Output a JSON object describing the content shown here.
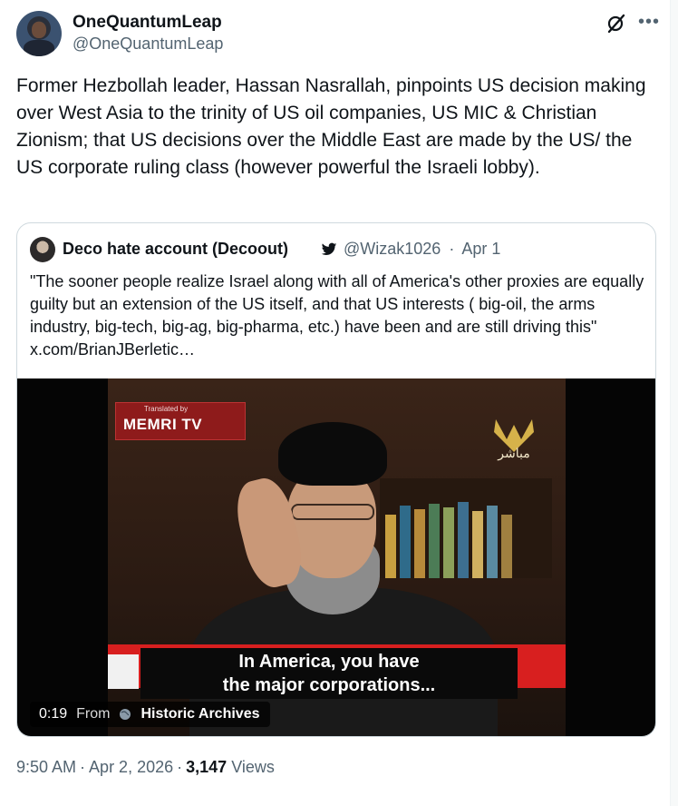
{
  "author": {
    "name": "OneQuantumLeap",
    "handle": "@OneQuantumLeap"
  },
  "post": {
    "text": "Former Hezbollah leader, Hassan Nasrallah, pinpoints US decision making over West Asia to the trinity of US oil companies, US MIC & Christian Zionism; that US decisions over the Middle East are made by the US/ the US corporate ruling class (however powerful the Israeli lobby)."
  },
  "icons": {
    "grok": "grok-icon",
    "more": "more-icon",
    "bird": "twitter-bird-icon",
    "globe": "globe-icon"
  },
  "quote": {
    "name": "Deco hate account (Decoout)",
    "handle": "@Wizak1026",
    "date": "Apr 1",
    "text": "\"The sooner people realize Israel along with all of America's other proxies are equally guilty but an extension of the US itself, and that US interests ( big-oil, the arms industry, big-tech, big-ag, big-pharma, etc.) have been and are still driving this\"  x.com/BrianJBerletic…",
    "video": {
      "overlay_badge_small": "Translated by",
      "overlay_badge": "MEMRI TV",
      "channel_text": "مباشر",
      "subtitle_line1": "In America, you have",
      "subtitle_line2": "the major corporations...",
      "duration": "0:19",
      "from_label": "From",
      "source": "Historic Archives"
    }
  },
  "footer": {
    "time": "9:50 AM",
    "date": "Apr 2, 2026",
    "views_count": "3,147",
    "views_label": "Views"
  },
  "colors": {
    "text_primary": "#0f1419",
    "text_secondary": "#536471",
    "border": "#cfd9de"
  }
}
